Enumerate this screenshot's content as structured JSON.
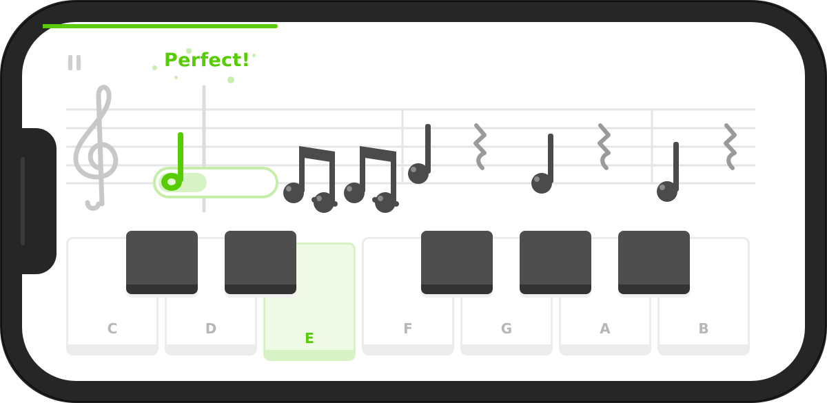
{
  "feedback": {
    "text": "Perfect!"
  },
  "progress": {
    "fraction": 0.3
  },
  "piano": {
    "keys": [
      {
        "label": "C",
        "active": false
      },
      {
        "label": "D",
        "active": false
      },
      {
        "label": "E",
        "active": true
      },
      {
        "label": "F",
        "active": false
      },
      {
        "label": "G",
        "active": false
      },
      {
        "label": "A",
        "active": false
      },
      {
        "label": "B",
        "active": false
      }
    ]
  },
  "colors": {
    "accent": "#58cc02",
    "frame": "#262626",
    "note": "#4b4b4b",
    "staff_line": "#e5e5e5"
  },
  "icons": {
    "pause": "pause-icon",
    "clef": "treble-clef-icon",
    "rest": "quarter-rest-icon"
  }
}
